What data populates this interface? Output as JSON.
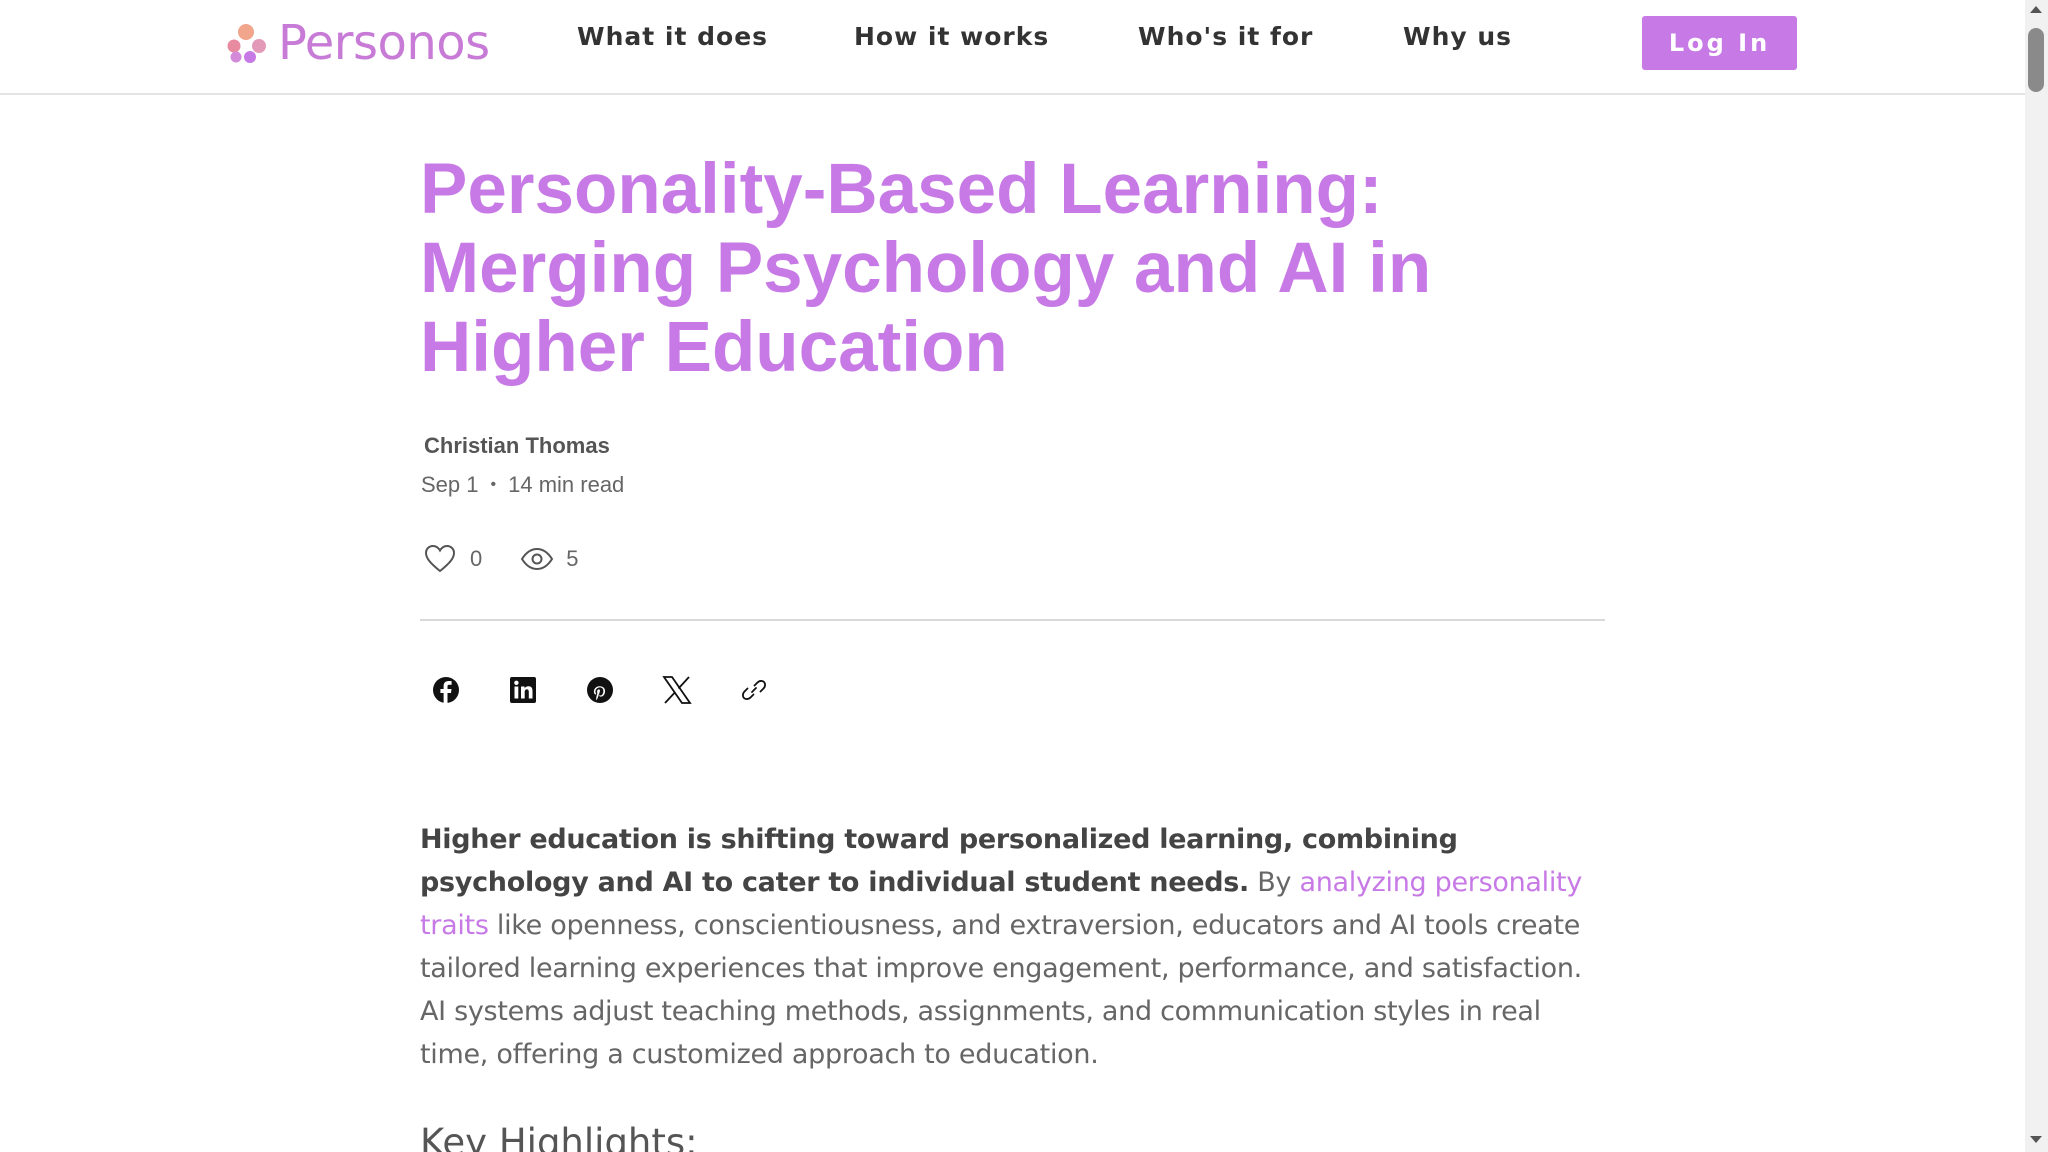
{
  "header": {
    "brand": "Personos",
    "nav": [
      {
        "label": "What it does"
      },
      {
        "label": "How it works"
      },
      {
        "label": "Who's it for"
      },
      {
        "label": "Why us"
      }
    ],
    "login_label": "Log In"
  },
  "article": {
    "title": "Personality-Based Learning: Merging Psychology and AI in Higher Education",
    "author": "Christian Thomas",
    "date": "Sep 1",
    "separator": "•",
    "read_time": "14 min read",
    "likes": "0",
    "views": "5",
    "share_icons": [
      "facebook-icon",
      "linkedin-icon",
      "pinterest-icon",
      "x-icon",
      "link-icon"
    ],
    "intro_bold": "Higher education is shifting toward personalized learning, combining psychology and AI to cater to individual student needs.",
    "intro_pre_link": " By ",
    "intro_link": "analyzing personality traits",
    "intro_rest": " like openness, conscientiousness, and extraversion, educators and AI tools create tailored learning experiences that improve engagement, performance, and satisfaction. AI systems adjust teaching methods, assignments, and communication styles in real time, offering a customized approach to education.",
    "section_heading": "Key Highlights:"
  },
  "colors": {
    "accent": "#c77ae6",
    "logo_dots": [
      "#f0a58c",
      "#e88aa0",
      "#d38ad8",
      "#c77ae6"
    ]
  }
}
